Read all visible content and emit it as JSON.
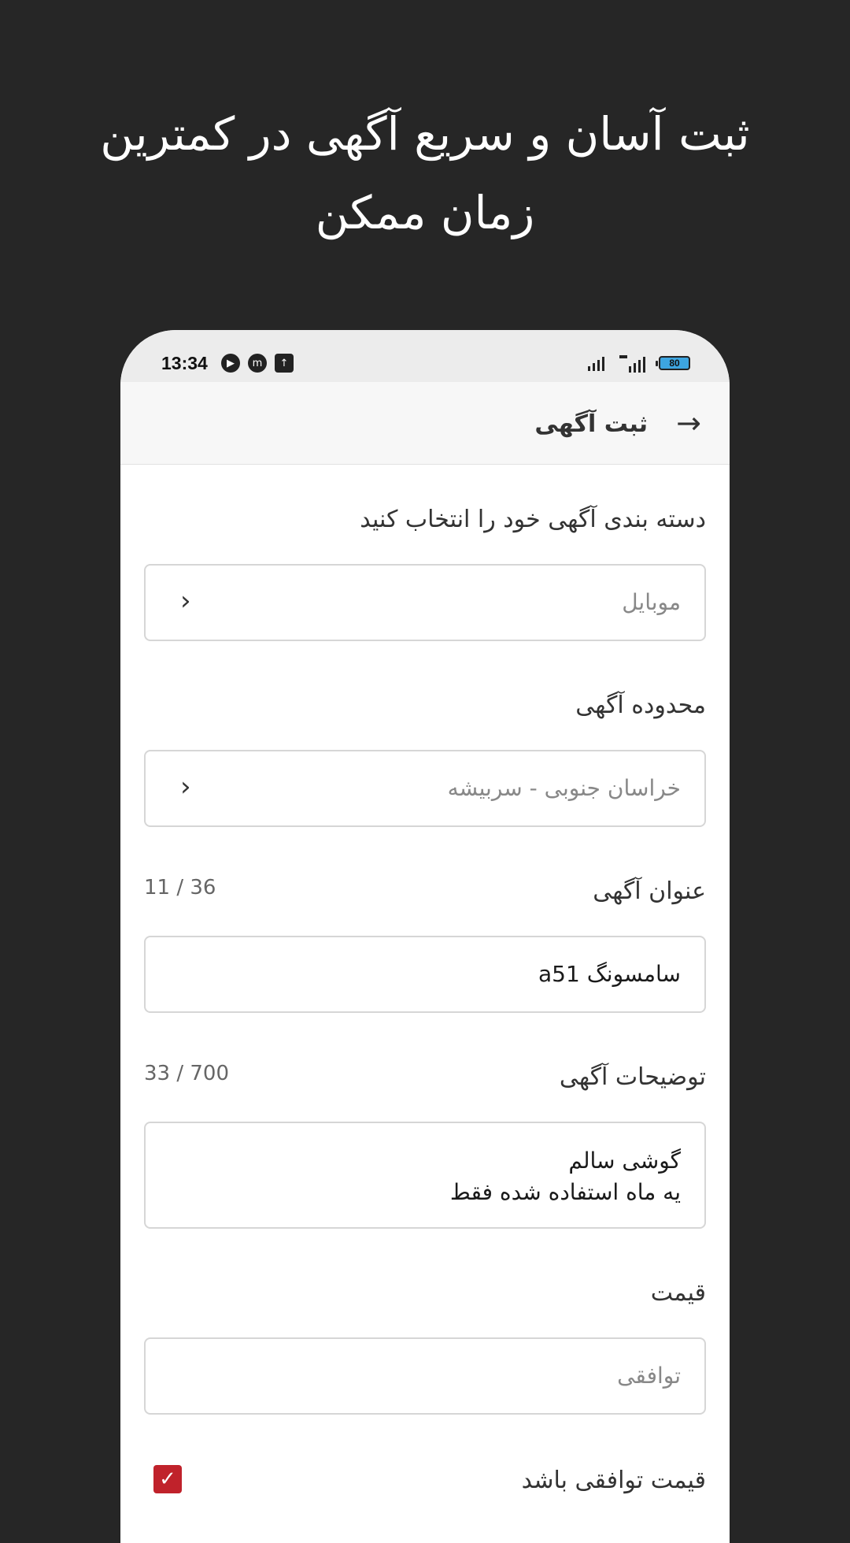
{
  "headline": {
    "line1": "ثبت آسان و سریع آگهی در کمترین",
    "line2": "زمان ممکن"
  },
  "status_bar": {
    "time": "13:34",
    "battery": "80",
    "icons_left": [
      "play-icon",
      "m-icon",
      "upload-icon"
    ],
    "icons_right": [
      "signal-icon",
      "signal-4g-icon",
      "battery-icon"
    ]
  },
  "app_bar": {
    "title": "ثبت آگهی",
    "back_icon": "arrow-right-icon"
  },
  "form": {
    "category": {
      "label": "دسته بندی آگهی خود را انتخاب کنید",
      "value": "موبایل"
    },
    "region": {
      "label": "محدوده آگهی",
      "value": "خراسان جنوبی - سربیشه"
    },
    "title": {
      "label": "عنوان آگهی",
      "counter": "11 / 36",
      "value": "سامسونگ a51"
    },
    "description": {
      "label": "توضیحات آگهی",
      "counter": "33 / 700",
      "line1": "گوشی سالم",
      "line2": "یه ماه استفاده شده فقط"
    },
    "price": {
      "label": "قیمت",
      "placeholder": "توافقی"
    },
    "negotiable": {
      "label": "قیمت توافقی باشد",
      "checked": true,
      "color": "#c0222b"
    }
  }
}
